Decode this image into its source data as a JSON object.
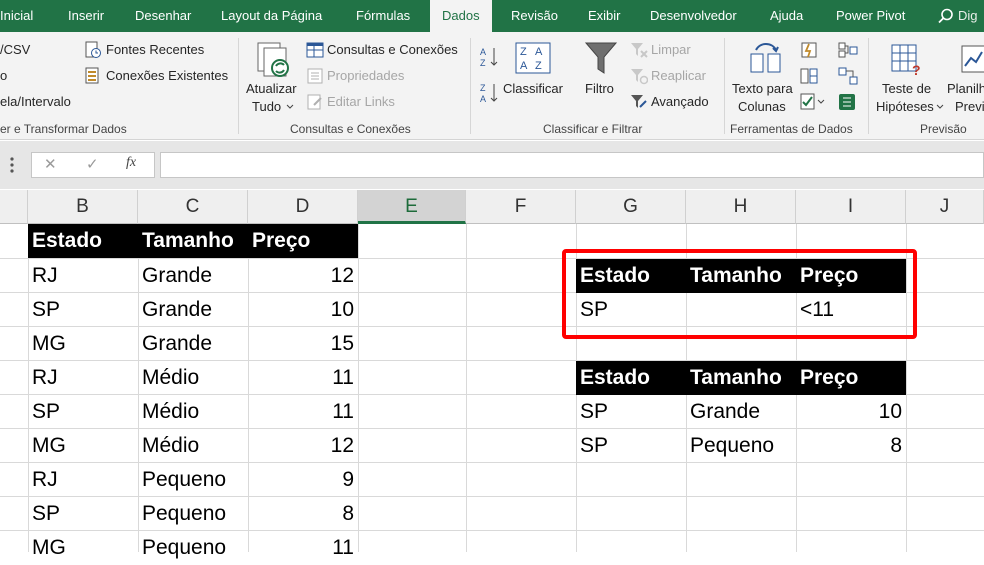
{
  "tabs": [
    {
      "label": "Inicial"
    },
    {
      "label": "Inserir"
    },
    {
      "label": "Desenhar"
    },
    {
      "label": "Layout da Página"
    },
    {
      "label": "Fórmulas"
    },
    {
      "label": "Dados",
      "active": true
    },
    {
      "label": "Revisão"
    },
    {
      "label": "Exibir"
    },
    {
      "label": "Desenvolvedor"
    },
    {
      "label": "Ajuda"
    },
    {
      "label": "Power Pivot"
    }
  ],
  "search": {
    "text": "Dig"
  },
  "ribbon": {
    "get_data": {
      "items": [
        "/CSV",
        "o",
        "ela/Intervalo",
        "Fontes Recentes",
        "Conexões Existentes"
      ],
      "group_name": "er e Transformar Dados"
    },
    "queries": {
      "refresh_line1": "Atualizar",
      "refresh_line2": "Tudo",
      "queries_connections": "Consultas e Conexões",
      "properties": "Propriedades",
      "edit_links": "Editar Links",
      "group_name": "Consultas e Conexões"
    },
    "sort_filter": {
      "sort": "Classificar",
      "filter": "Filtro",
      "clear": "Limpar",
      "reapply": "Reaplicar",
      "advanced": "Avançado",
      "group_name": "Classificar e Filtrar"
    },
    "data_tools": {
      "text_to_columns_line1": "Texto para",
      "text_to_columns_line2": "Colunas",
      "group_name": "Ferramentas de Dados"
    },
    "forecast": {
      "whatif_line1": "Teste de",
      "whatif_line2": "Hipóteses",
      "sheet_line1": "Planilh",
      "sheet_line2": "Previ",
      "group_name": "Previsão"
    }
  },
  "formula_bar": {
    "cancel": "✕",
    "enter": "✓",
    "fx": "fx",
    "value": ""
  },
  "columns": [
    "B",
    "C",
    "D",
    "E",
    "F",
    "G",
    "H",
    "I",
    "J"
  ],
  "selected_column": "E",
  "main_table": {
    "headers": [
      "Estado",
      "Tamanho",
      "Preço"
    ],
    "rows": [
      [
        "RJ",
        "Grande",
        "12"
      ],
      [
        "SP",
        "Grande",
        "10"
      ],
      [
        "MG",
        "Grande",
        "15"
      ],
      [
        "RJ",
        "Médio",
        "11"
      ],
      [
        "SP",
        "Médio",
        "11"
      ],
      [
        "MG",
        "Médio",
        "12"
      ],
      [
        "RJ",
        "Pequeno",
        "9"
      ],
      [
        "SP",
        "Pequeno",
        "8"
      ],
      [
        "MG",
        "Pequeno",
        "11"
      ]
    ]
  },
  "criteria_table": {
    "headers": [
      "Estado",
      "Tamanho",
      "Preço"
    ],
    "rows": [
      [
        "SP",
        "",
        "<11"
      ]
    ]
  },
  "result_table": {
    "headers": [
      "Estado",
      "Tamanho",
      "Preço"
    ],
    "rows": [
      [
        "SP",
        "Grande",
        "10"
      ],
      [
        "SP",
        "Pequeno",
        "8"
      ]
    ]
  },
  "colors": {
    "excel_green": "#217346",
    "highlight": "#ff0000",
    "header_fill": "#000000"
  }
}
